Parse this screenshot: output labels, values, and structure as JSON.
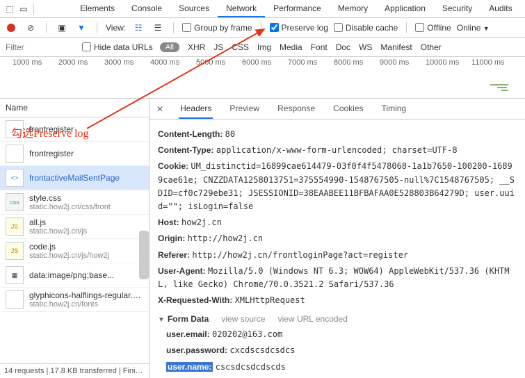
{
  "top_icons": {
    "inspect": "⬚",
    "device": "📱"
  },
  "main_tabs": [
    "Elements",
    "Console",
    "Sources",
    "Network",
    "Performance",
    "Memory",
    "Application",
    "Security",
    "Audits"
  ],
  "active_main_tab": "Network",
  "toolbar2": {
    "view_label": "View:",
    "group_by_frame": "Group by frame",
    "preserve_log": "Preserve log",
    "disable_cache": "Disable cache",
    "offline": "Offline",
    "online": "Online",
    "preserve_log_checked": true
  },
  "filter_row": {
    "placeholder": "Filter",
    "hide_data_urls": "Hide data URLs",
    "types": [
      "All",
      "XHR",
      "JS",
      "CSS",
      "Img",
      "Media",
      "Font",
      "Doc",
      "WS",
      "Manifest",
      "Other"
    ]
  },
  "timeline": {
    "ticks": [
      "1000 ms",
      "2000 ms",
      "3000 ms",
      "4000 ms",
      "5000 ms",
      "6000 ms",
      "7000 ms",
      "8000 ms",
      "9000 ms",
      "10000 ms",
      "11000 ms"
    ]
  },
  "name_header": "Name",
  "annotation": "勾选Preserve log",
  "files": [
    {
      "name": "frontregister",
      "sub": "",
      "icon": ""
    },
    {
      "name": "frontregister",
      "sub": "",
      "icon": ""
    },
    {
      "name": "frontactiveMailSentPage",
      "sub": "",
      "icon": "<>",
      "selected": true
    },
    {
      "name": "style.css",
      "sub": "static.how2j.cn/css/front",
      "icon": "css"
    },
    {
      "name": "all.js",
      "sub": "static.how2j.cn/js",
      "icon": "JS"
    },
    {
      "name": "code.js",
      "sub": "static.how2j.cn/js/how2j",
      "icon": "JS"
    },
    {
      "name": "data:image/png;base...",
      "sub": "",
      "icon": "▦"
    },
    {
      "name": "glyphicons-halflings-regular.wof",
      "sub": "static.how2j.cn/fonts",
      "icon": ""
    }
  ],
  "status_bar": "14 requests  |  17.8 KB transferred  |  Fini…",
  "detail_tabs": [
    "Headers",
    "Preview",
    "Response",
    "Cookies",
    "Timing"
  ],
  "active_detail_tab": "Headers",
  "headers": [
    {
      "k": "Content-Length:",
      "v": "80"
    },
    {
      "k": "Content-Type:",
      "v": "application/x-www-form-urlencoded; charset=UTF-8"
    },
    {
      "k": "Cookie:",
      "v": "UM_distinctid=16899cae614479-03f0f4f5478068-1a1b7650-100200-16899cae61e; CNZZDATA1258013751=375554990-1548767505-null%7C1548767505; __SDID=cf0c729ebe31; JSESSIONID=38EAABEE11BFBAFAA0E528803B64279D; user.uuid=\"\"; isLogin=false"
    },
    {
      "k": "Host:",
      "v": "how2j.cn"
    },
    {
      "k": "Origin:",
      "v": "http://how2j.cn"
    },
    {
      "k": "Referer:",
      "v": "http://how2j.cn/frontloginPage?act=register"
    },
    {
      "k": "User-Agent:",
      "v": "Mozilla/5.0 (Windows NT 6.3; WOW64) AppleWebKit/537.36 (KHTML, like Gecko) Chrome/70.0.3521.2 Safari/537.36"
    },
    {
      "k": "X-Requested-With:",
      "v": "XMLHttpRequest"
    }
  ],
  "form_section": {
    "title": "Form Data",
    "view_source": "view source",
    "view_url": "view URL encoded",
    "items": [
      {
        "k": "user.email:",
        "v": "020202@163.com"
      },
      {
        "k": "user.password:",
        "v": "cxcdscsdcsdcs"
      },
      {
        "k": "user.name:",
        "v": "cscsdcsdcdscds",
        "highlight": true
      }
    ]
  }
}
